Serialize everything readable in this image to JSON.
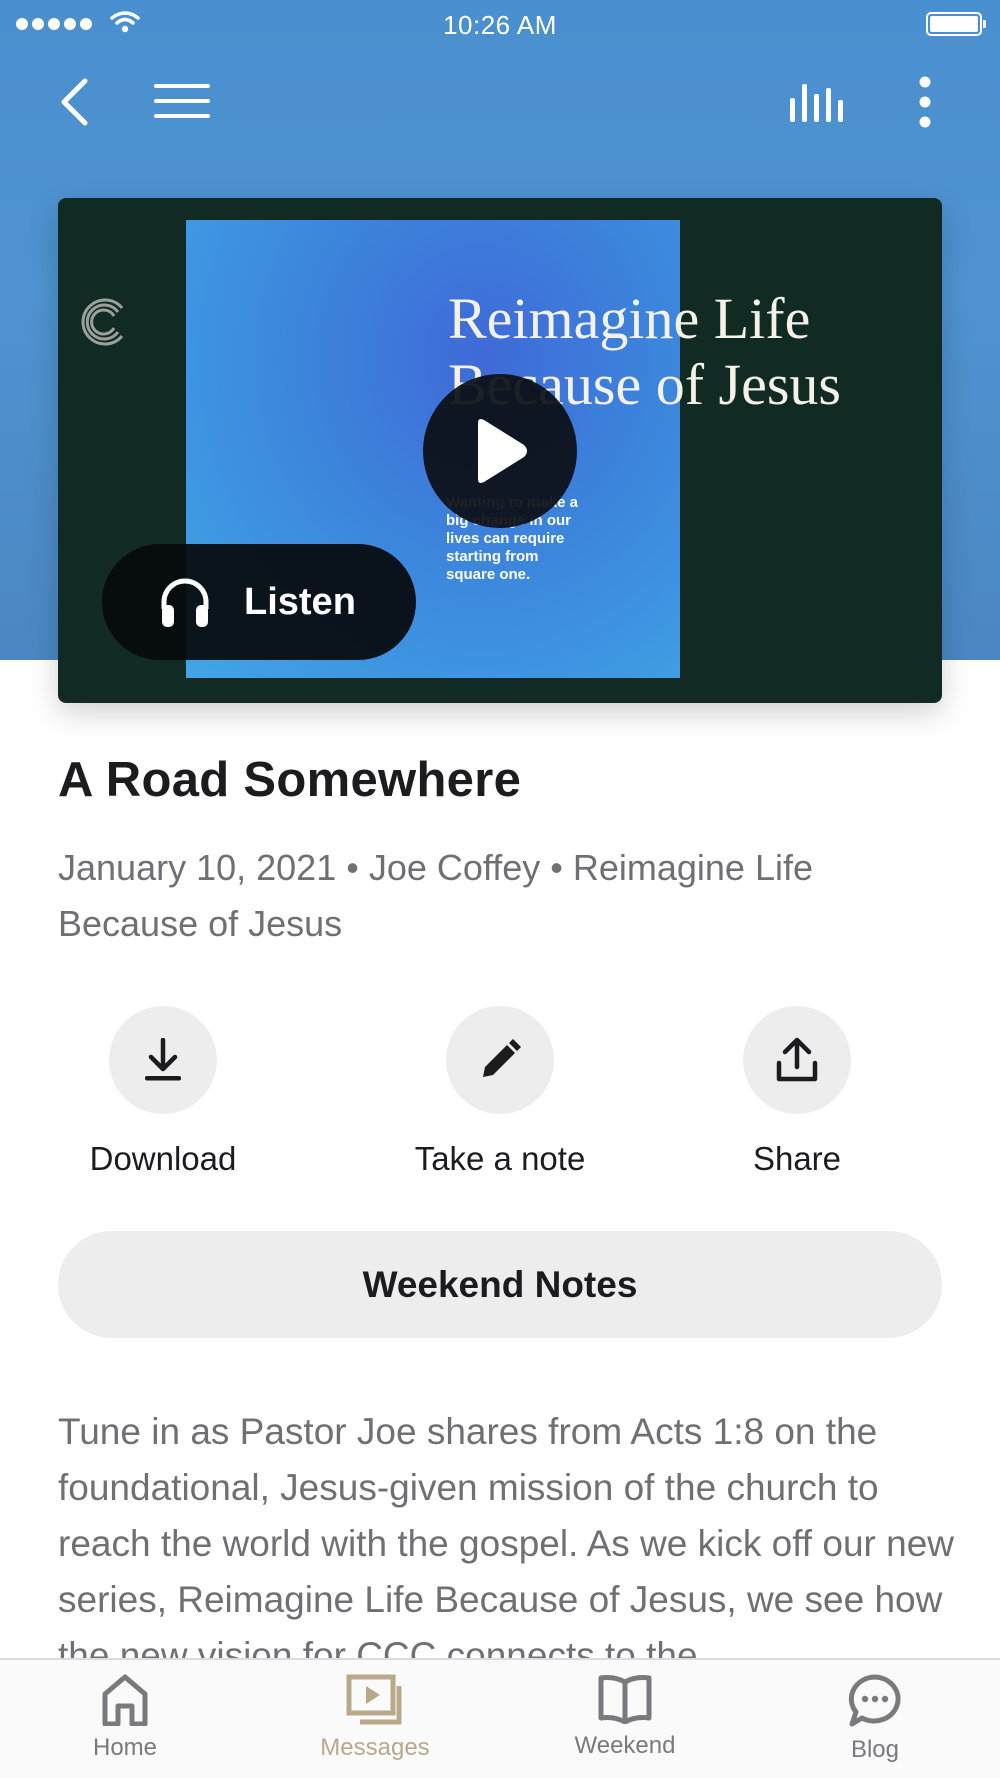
{
  "status_bar": {
    "time": "10:26 AM"
  },
  "nav": {
    "back_icon": "chevron-left-icon",
    "menu_icon": "hamburger-icon",
    "audio_icon": "equalizer-icon",
    "more_icon": "more-vertical-icon"
  },
  "media": {
    "headline_line1": "Reimagine Life",
    "headline_line2": "Because of Jesus",
    "blurb": "Wanting to make a big change in our lives can require starting from square one.",
    "listen_label": "Listen"
  },
  "message": {
    "title": "A Road Somewhere",
    "meta": "January 10, 2021 • Joe Coffey • Reimagine Life Because of Jesus"
  },
  "actions": [
    {
      "label": "Download",
      "icon": "download-icon"
    },
    {
      "label": "Take a note",
      "icon": "pencil-icon"
    },
    {
      "label": "Share",
      "icon": "share-icon"
    }
  ],
  "notes_button": "Weekend Notes",
  "description": "Tune in as Pastor Joe shares from Acts 1:8 on the foundational, Jesus-given mission of the church to reach the world with the gospel. As we kick off our new series, Reimagine Life Because of Jesus, we see how the new vision for CCC connects to the",
  "tabs": [
    {
      "label": "Home",
      "active": false
    },
    {
      "label": "Messages",
      "active": true
    },
    {
      "label": "Weekend",
      "active": false
    },
    {
      "label": "Blog",
      "active": false
    }
  ],
  "colors": {
    "header_blue": "#4f93d1",
    "card_dark": "#112b24",
    "active_tab": "#b9a98a",
    "muted_text": "#707074"
  }
}
